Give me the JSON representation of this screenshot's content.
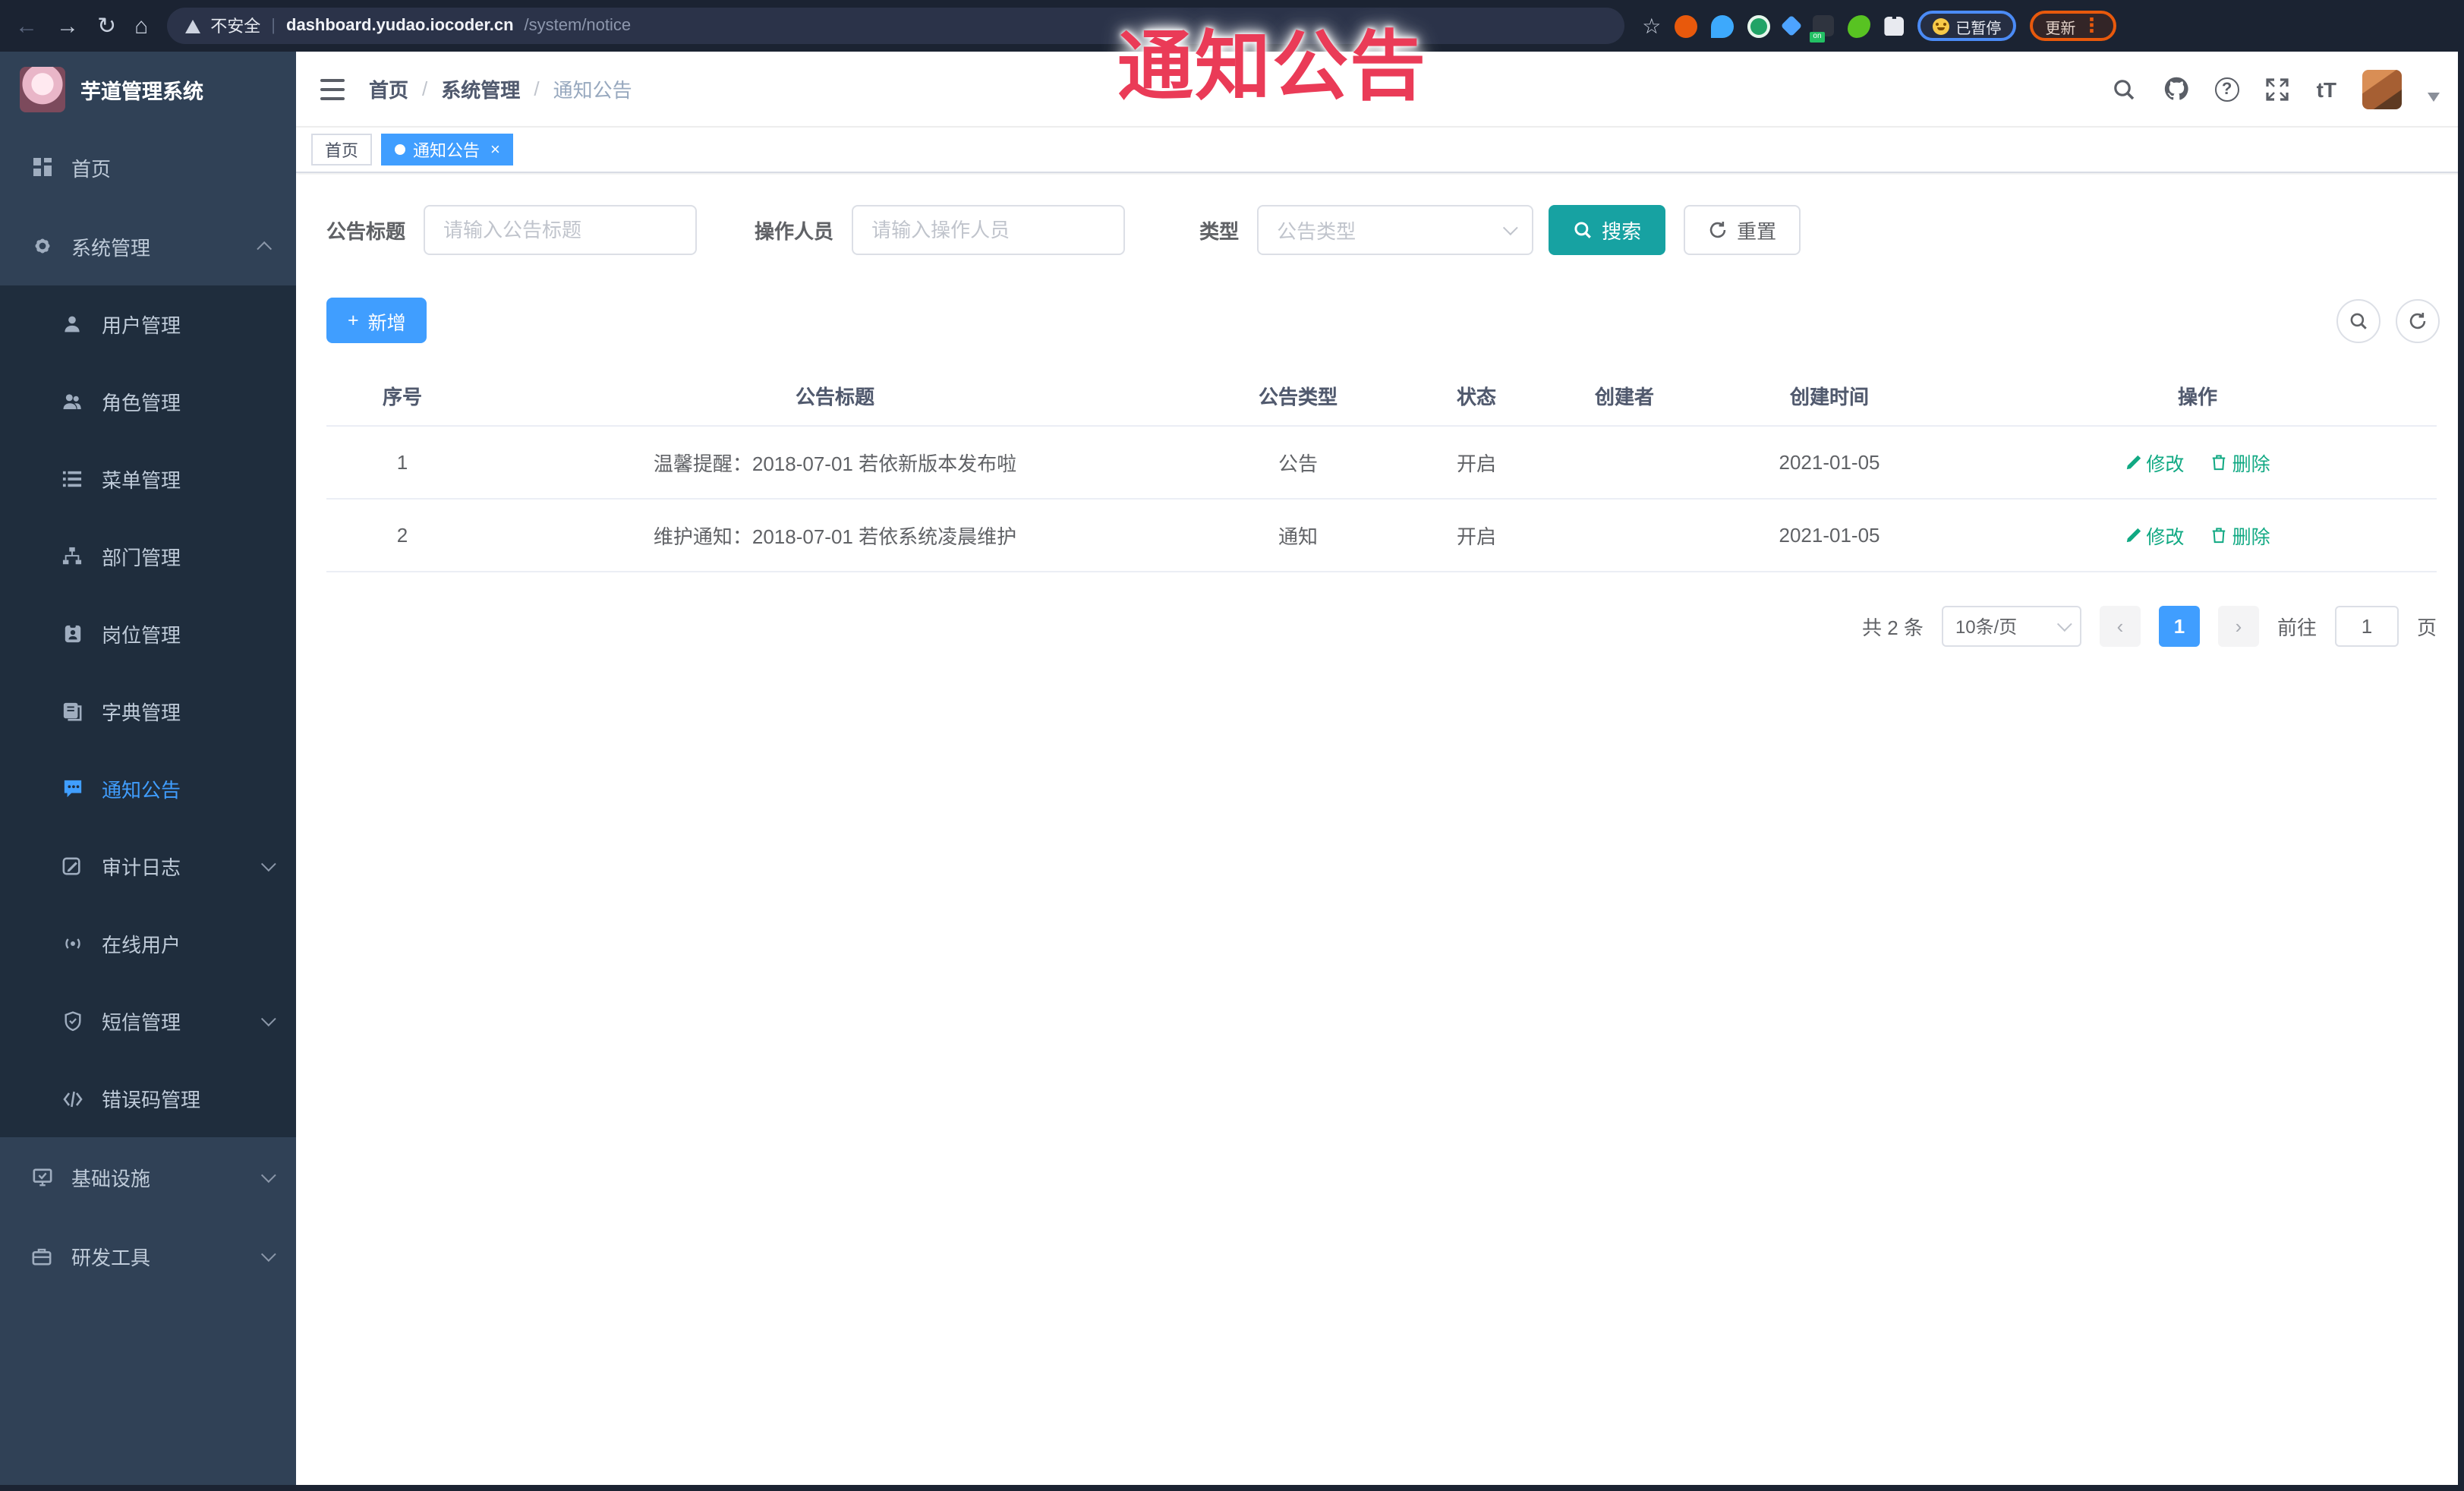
{
  "browser": {
    "security_label": "不安全",
    "url_host": "dashboard.yudao.iocoder.cn",
    "url_path": "/system/notice",
    "extension_badge": "on",
    "paused_chip_label": "已暂停",
    "update_chip_label": "更新"
  },
  "annotation": {
    "text": "通知公告"
  },
  "sidebar": {
    "brand": "芋道管理系统",
    "items": [
      {
        "label": "首页"
      },
      {
        "label": "系统管理"
      },
      {
        "label": "用户管理"
      },
      {
        "label": "角色管理"
      },
      {
        "label": "菜单管理"
      },
      {
        "label": "部门管理"
      },
      {
        "label": "岗位管理"
      },
      {
        "label": "字典管理"
      },
      {
        "label": "通知公告"
      },
      {
        "label": "审计日志"
      },
      {
        "label": "在线用户"
      },
      {
        "label": "短信管理"
      },
      {
        "label": "错误码管理"
      },
      {
        "label": "基础设施"
      },
      {
        "label": "研发工具"
      }
    ]
  },
  "navbar": {
    "breadcrumb": [
      "首页",
      "系统管理",
      "通知公告"
    ]
  },
  "tabs": [
    {
      "label": "首页"
    },
    {
      "label": "通知公告"
    }
  ],
  "filters": {
    "title_label": "公告标题",
    "title_placeholder": "请输入公告标题",
    "operator_label": "操作人员",
    "operator_placeholder": "请输入操作人员",
    "type_label": "类型",
    "type_placeholder": "公告类型",
    "search_label": "搜索",
    "reset_label": "重置"
  },
  "toolbar": {
    "add_label": "新增"
  },
  "table": {
    "columns": [
      "序号",
      "公告标题",
      "公告类型",
      "状态",
      "创建者",
      "创建时间",
      "操作"
    ],
    "rows": [
      {
        "no": "1",
        "title": "温馨提醒：2018-07-01 若依新版本发布啦",
        "type": "公告",
        "status": "开启",
        "creator": "",
        "created": "2021-01-05",
        "edit": "修改",
        "delete": "删除"
      },
      {
        "no": "2",
        "title": "维护通知：2018-07-01 若依系统凌晨维护",
        "type": "通知",
        "status": "开启",
        "creator": "",
        "created": "2021-01-05",
        "edit": "修改",
        "delete": "删除"
      }
    ]
  },
  "pagination": {
    "total": "共 2 条",
    "page_size": "10条/页",
    "current_page": "1",
    "goto_label": "前往",
    "goto_value": "1",
    "page_unit": "页"
  },
  "colors": {
    "primary": "#409eff",
    "search_teal": "#17a2a2",
    "action_teal": "#11a983",
    "annotation_red": "#ea3b57"
  }
}
